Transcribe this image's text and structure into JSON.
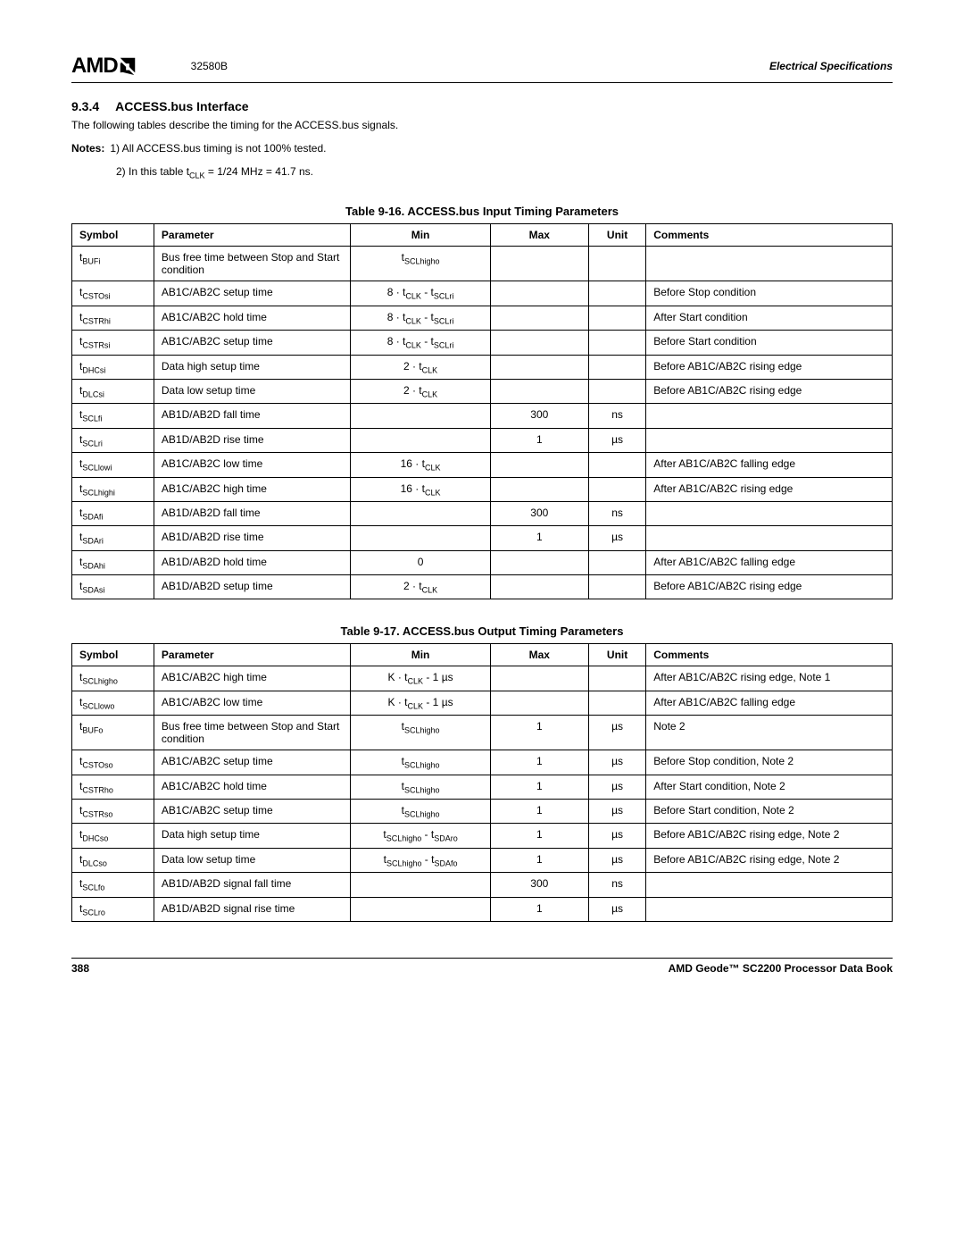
{
  "header": {
    "logo_brand": "AMD",
    "doc_number": "32580B",
    "section_title": "Electrical Specifications"
  },
  "section": {
    "number": "9.3.4",
    "title": "ACCESS.bus Interface",
    "intro": "The following tables describe the timing for the ACCESS.bus signals.",
    "notes_label": "Notes:",
    "notes": [
      "1)  All ACCESS.bus timing is not 100% tested.",
      "2)  In this table t_CLK = 1/24 MHz = 41.7 ns."
    ]
  },
  "table1": {
    "title": "Table 9-16.  ACCESS.bus Input Timing Parameters",
    "headers": {
      "c0": "Symbol",
      "c1": "Parameter",
      "c2": "Min",
      "c3": "Max",
      "c4": "Unit",
      "c5": "Comments"
    },
    "rows": [
      {
        "sym_base": "t",
        "sym_sub": "BUFi",
        "param": "Bus free time between Stop and Start condition",
        "min_type": "tsub",
        "min_plain": "",
        "min_sub": "SCLhigho",
        "max": "",
        "unit": "",
        "comments": ""
      },
      {
        "sym_base": "t",
        "sym_sub": "CSTOsi",
        "param": "AB1C/AB2C setup time",
        "min_type": "expr_sub",
        "min_prefix": "8 · t",
        "min_mid_sub": "CLK",
        "min_suffix": " - t",
        "min_suffix_sub": "SCLri",
        "max": "",
        "unit": "",
        "comments": "Before Stop condition"
      },
      {
        "sym_base": "t",
        "sym_sub": "CSTRhi",
        "param": "AB1C/AB2C hold time",
        "min_type": "expr_sub",
        "min_prefix": "8 · t",
        "min_mid_sub": "CLK",
        "min_suffix": " - t",
        "min_suffix_sub": "SCLri",
        "max": "",
        "unit": "",
        "comments": "After Start condition"
      },
      {
        "sym_base": "t",
        "sym_sub": "CSTRsi",
        "param": "AB1C/AB2C setup time",
        "min_type": "expr_sub",
        "min_prefix": "8 · t",
        "min_mid_sub": "CLK",
        "min_suffix": " - t",
        "min_suffix_sub": "SCLri",
        "max": "",
        "unit": "",
        "comments": "Before Start condition"
      },
      {
        "sym_base": "t",
        "sym_sub": "DHCsi",
        "param": "Data high setup time",
        "min_type": "tclk",
        "min_prefix": "2 · t",
        "min_mid_sub": "CLK",
        "max": "",
        "unit": "",
        "comments": "Before AB1C/AB2C rising edge"
      },
      {
        "sym_base": "t",
        "sym_sub": "DLCsi",
        "param": "Data low setup time",
        "min_type": "tclk",
        "min_prefix": "2 · t",
        "min_mid_sub": "CLK",
        "max": "",
        "unit": "",
        "comments": "Before AB1C/AB2C rising edge"
      },
      {
        "sym_base": "t",
        "sym_sub": "SCLfi",
        "param": "AB1D/AB2D fall time",
        "min_type": "plain",
        "min_plain": "",
        "max": "300",
        "unit": "ns",
        "comments": ""
      },
      {
        "sym_base": "t",
        "sym_sub": "SCLri",
        "param": "AB1D/AB2D rise time",
        "min_type": "plain",
        "min_plain": "",
        "max": "1",
        "unit": "µs",
        "comments": ""
      },
      {
        "sym_base": "t",
        "sym_sub": "SCLlowi",
        "param": "AB1C/AB2C low time",
        "min_type": "tclk",
        "min_prefix": "16 · t",
        "min_mid_sub": "CLK",
        "max": "",
        "unit": "",
        "comments": "After AB1C/AB2C falling edge"
      },
      {
        "sym_base": "t",
        "sym_sub": "SCLhighi",
        "param": "AB1C/AB2C high time",
        "min_type": "tclk",
        "min_prefix": "16 · t",
        "min_mid_sub": "CLK",
        "max": "",
        "unit": "",
        "comments": "After AB1C/AB2C rising edge"
      },
      {
        "sym_base": "t",
        "sym_sub": "SDAfi",
        "param": "AB1D/AB2D fall time",
        "min_type": "plain",
        "min_plain": "",
        "max": "300",
        "unit": "ns",
        "comments": ""
      },
      {
        "sym_base": "t",
        "sym_sub": "SDAri",
        "param": "AB1D/AB2D rise time",
        "min_type": "plain",
        "min_plain": "",
        "max": "1",
        "unit": "µs",
        "comments": ""
      },
      {
        "sym_base": "t",
        "sym_sub": "SDAhi",
        "param": "AB1D/AB2D hold time",
        "min_type": "plain",
        "min_plain": "0",
        "max": "",
        "unit": "",
        "comments": "After AB1C/AB2C falling edge"
      },
      {
        "sym_base": "t",
        "sym_sub": "SDAsi",
        "param": "AB1D/AB2D setup time",
        "min_type": "tclk",
        "min_prefix": "2 · t",
        "min_mid_sub": "CLK",
        "max": "",
        "unit": "",
        "comments": "Before AB1C/AB2C rising edge"
      }
    ]
  },
  "table2": {
    "title": "Table 9-17.  ACCESS.bus Output Timing Parameters",
    "headers": {
      "c0": "Symbol",
      "c1": "Parameter",
      "c2": "Min",
      "c3": "Max",
      "c4": "Unit",
      "c5": "Comments"
    },
    "rows": [
      {
        "sym_base": "t",
        "sym_sub": "SCLhigho",
        "param": "AB1C/AB2C high time",
        "min_type": "ktclk",
        "min_prefix": "K · t",
        "min_mid_sub": "CLK",
        "min_suffix_plain": " - 1 µs",
        "max": "",
        "unit": "",
        "comments": "After AB1C/AB2C rising edge, Note 1"
      },
      {
        "sym_base": "t",
        "sym_sub": "SCLlowo",
        "param": "AB1C/AB2C low time",
        "min_type": "ktclk",
        "min_prefix": "K · t",
        "min_mid_sub": "CLK",
        "min_suffix_plain": " - 1 µs",
        "max": "",
        "unit": "",
        "comments": "After AB1C/AB2C falling edge"
      },
      {
        "sym_base": "t",
        "sym_sub": "BUFo",
        "param": "Bus free time between Stop and Start condition",
        "min_type": "tsub",
        "min_plain": "",
        "min_sub": "SCLhigho",
        "max": "1",
        "unit": "µs",
        "comments": "Note 2"
      },
      {
        "sym_base": "t",
        "sym_sub": "CSTOso",
        "param": "AB1C/AB2C setup time",
        "min_type": "tsub",
        "min_plain": "",
        "min_sub": "SCLhigho",
        "max": "1",
        "unit": "µs",
        "comments": "Before Stop condition, Note 2"
      },
      {
        "sym_base": "t",
        "sym_sub": "CSTRho",
        "param": "AB1C/AB2C hold time",
        "min_type": "tsub",
        "min_plain": "",
        "min_sub": "SCLhigho",
        "max": "1",
        "unit": "µs",
        "comments": "After Start condition, Note 2"
      },
      {
        "sym_base": "t",
        "sym_sub": "CSTRso",
        "param": "AB1C/AB2C setup time",
        "min_type": "tsub",
        "min_plain": "",
        "min_sub": "SCLhigho",
        "max": "1",
        "unit": "µs",
        "comments": "Before Start condition, Note 2"
      },
      {
        "sym_base": "t",
        "sym_sub": "DHCso",
        "param": "Data high setup time",
        "min_type": "diff_tsub",
        "min_sub1": "SCLhigho",
        "min_sub2": "SDAro",
        "max": "1",
        "unit": "µs",
        "comments": "Before AB1C/AB2C rising edge, Note 2"
      },
      {
        "sym_base": "t",
        "sym_sub": "DLCso",
        "param": "Data low setup time",
        "min_type": "diff_tsub",
        "min_sub1": "SCLhigho",
        "min_sub2": "SDAfo",
        "max": "1",
        "unit": "µs",
        "comments": "Before AB1C/AB2C rising edge, Note 2"
      },
      {
        "sym_base": "t",
        "sym_sub": "SCLfo",
        "param": "AB1D/AB2D signal fall time",
        "min_type": "plain",
        "min_plain": "",
        "max": "300",
        "unit": "ns",
        "comments": ""
      },
      {
        "sym_base": "t",
        "sym_sub": "SCLro",
        "param": "AB1D/AB2D signal rise time",
        "min_type": "plain",
        "min_plain": "",
        "max": "1",
        "unit": "µs",
        "comments": ""
      }
    ]
  },
  "footer": {
    "page_number": "388",
    "book_title": "AMD Geode™ SC2200  Processor Data Book"
  }
}
